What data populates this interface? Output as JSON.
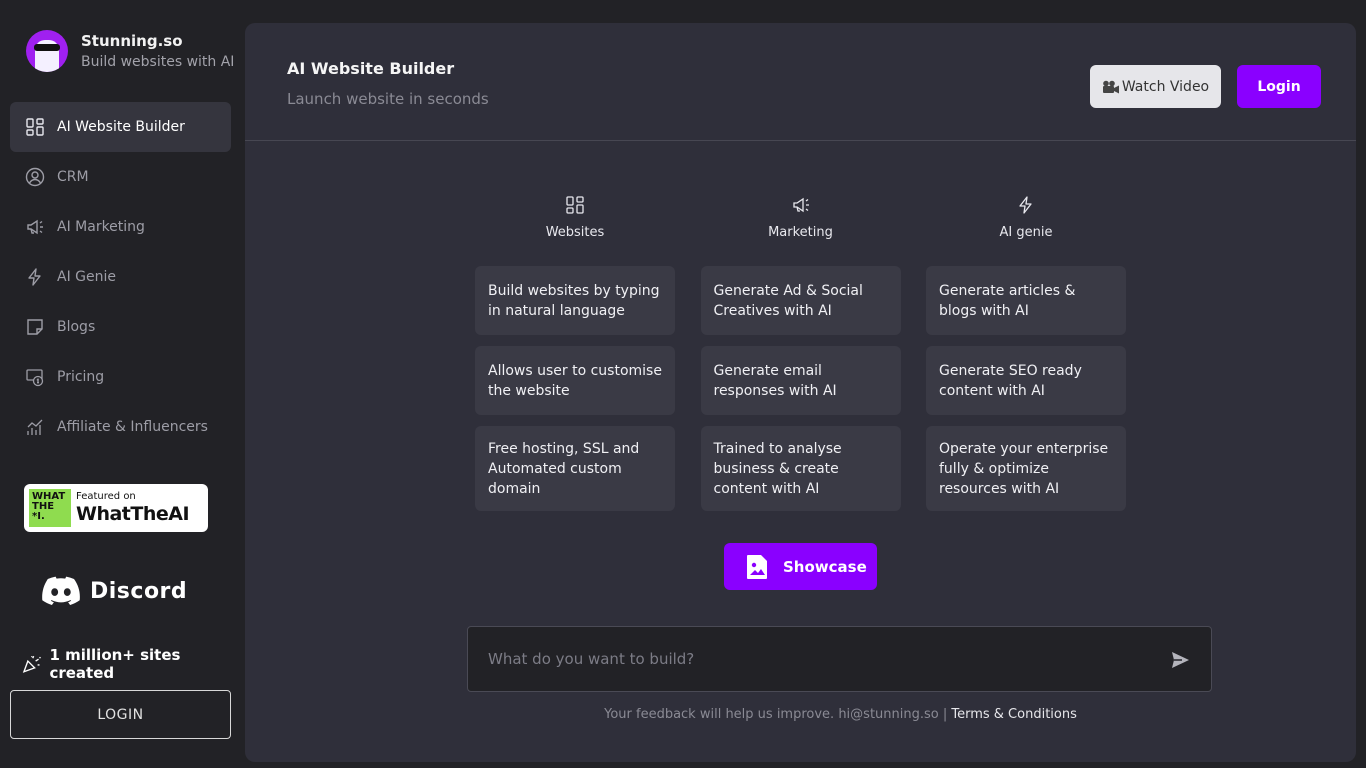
{
  "brand": {
    "name": "Stunning.so",
    "tagline": "Build websites with AI"
  },
  "sidebar": {
    "items": [
      {
        "label": "AI Website Builder",
        "icon": "grid-icon",
        "active": true
      },
      {
        "label": "CRM",
        "icon": "user-circle-icon"
      },
      {
        "label": "AI Marketing",
        "icon": "megaphone-icon"
      },
      {
        "label": "AI Genie",
        "icon": "lightning-icon"
      },
      {
        "label": "Blogs",
        "icon": "note-icon"
      },
      {
        "label": "Pricing",
        "icon": "pricing-icon"
      },
      {
        "label": "Affiliate & Influencers",
        "icon": "chart-icon"
      }
    ],
    "featured": {
      "box_line1": "WHAT",
      "box_line2": "THE",
      "box_line3": "*I.",
      "small": "Featured on",
      "big": "WhatTheAI"
    },
    "discord": "Discord",
    "sites_created": "1 million+ sites created",
    "login": "LOGIN"
  },
  "header": {
    "title": "AI Website Builder",
    "subtitle": "Launch website in seconds",
    "watch_video": "Watch Video",
    "login": "Login"
  },
  "columns": [
    {
      "label": "Websites",
      "icon": "grid-icon",
      "cards": [
        "Build websites by typing in natural language",
        "Allows user to customise the website",
        "Free hosting, SSL and Automated custom domain"
      ]
    },
    {
      "label": "Marketing",
      "icon": "megaphone-icon",
      "cards": [
        "Generate Ad & Social Creatives with AI",
        "Generate email responses with AI",
        "Trained to analyse business & create content with AI"
      ]
    },
    {
      "label": "AI genie",
      "icon": "lightning-icon",
      "cards": [
        "Generate articles & blogs with AI",
        "Generate SEO ready content with AI",
        "Operate your enterprise fully & optimize resources with AI"
      ]
    }
  ],
  "showcase": "Showcase",
  "prompt": {
    "placeholder": "What do you want to build?"
  },
  "footer": {
    "text": "Your feedback will help us improve. hi@stunning.so | ",
    "link": "Terms & Conditions"
  },
  "colors": {
    "accent": "#8a00ff",
    "panel": "#2f2f3a",
    "card": "#3a3a45",
    "background": "#222226"
  }
}
